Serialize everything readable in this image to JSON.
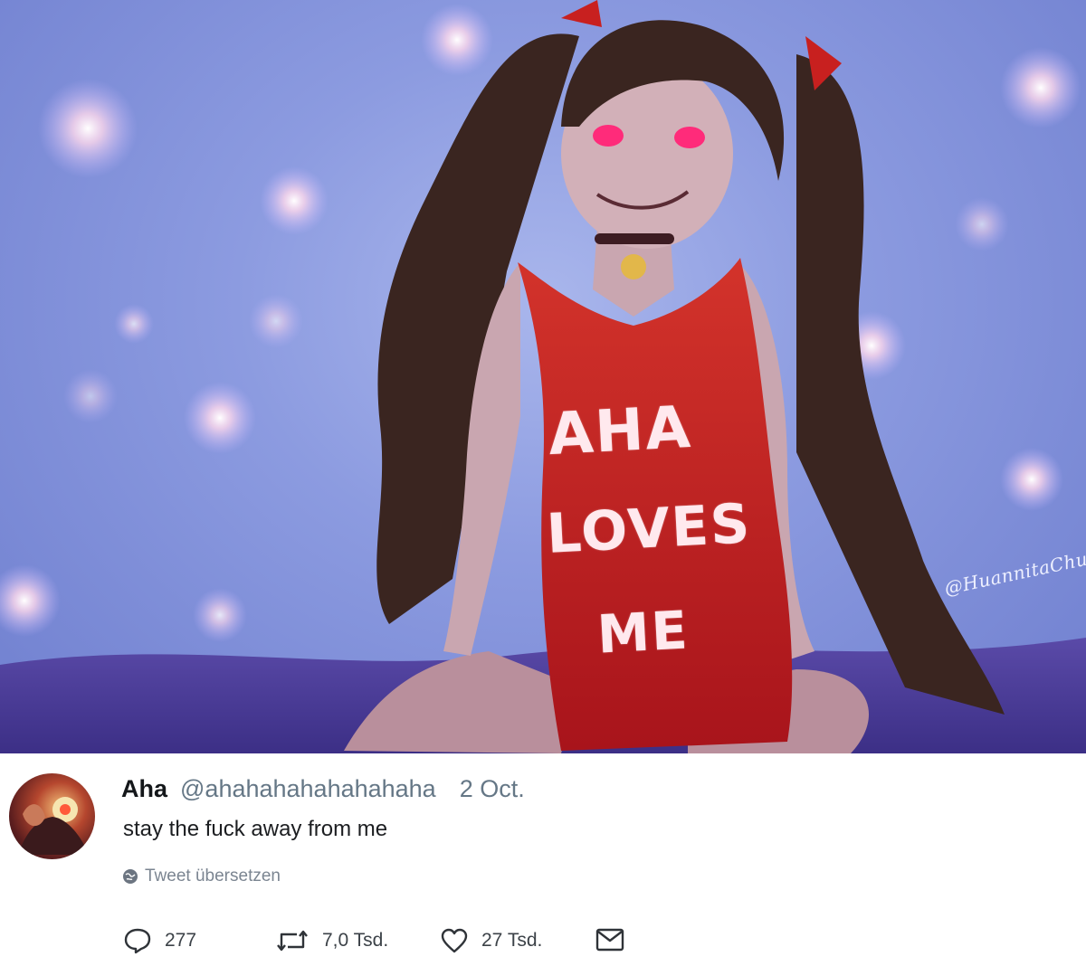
{
  "artwork": {
    "shirt_lines": [
      "AHA",
      "LOVES",
      "ME"
    ],
    "signature": "@HuannitaChu",
    "colors": {
      "background": "#8c9be0",
      "shirt": "#c8201f",
      "hair": "#3a2520",
      "skin": "#c9a6b0"
    }
  },
  "tweet": {
    "display_name": "Aha",
    "handle": "@ahahahahahahahaha",
    "date": "2 Oct.",
    "text": "stay the fuck away from me",
    "translate_label": "Tweet übersetzen",
    "actions": {
      "replies": "277",
      "retweets": "7,0 Tsd.",
      "likes": "27 Tsd."
    },
    "icons": [
      "reply-icon",
      "retweet-icon",
      "like-icon",
      "message-icon",
      "globe-icon"
    ]
  }
}
